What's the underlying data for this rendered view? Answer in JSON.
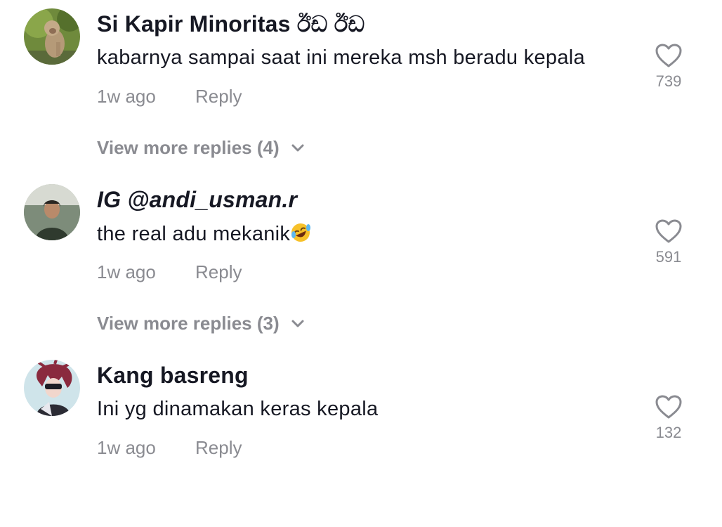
{
  "comments": [
    {
      "username": "Si Kapir Minoritas ඊඩ ඊඩ",
      "text": "kabarnya sampai saat ini mereka msh beradu kepala",
      "time": "1w ago",
      "reply_label": "Reply",
      "likes": "739",
      "view_more": "View more replies (4)"
    },
    {
      "username": "IG @andi_usman.r",
      "text": "the real adu mekanik",
      "emoji": "rolling-on-floor-laughing",
      "time": "1w ago",
      "reply_label": "Reply",
      "likes": "591",
      "view_more": "View more replies (3)"
    },
    {
      "username": "Kang basreng",
      "text": "Ini yg dinamakan keras kepala",
      "time": "1w ago",
      "reply_label": "Reply",
      "likes": "132"
    }
  ],
  "colors": {
    "text_primary": "#161823",
    "text_secondary": "#8a8b91"
  }
}
